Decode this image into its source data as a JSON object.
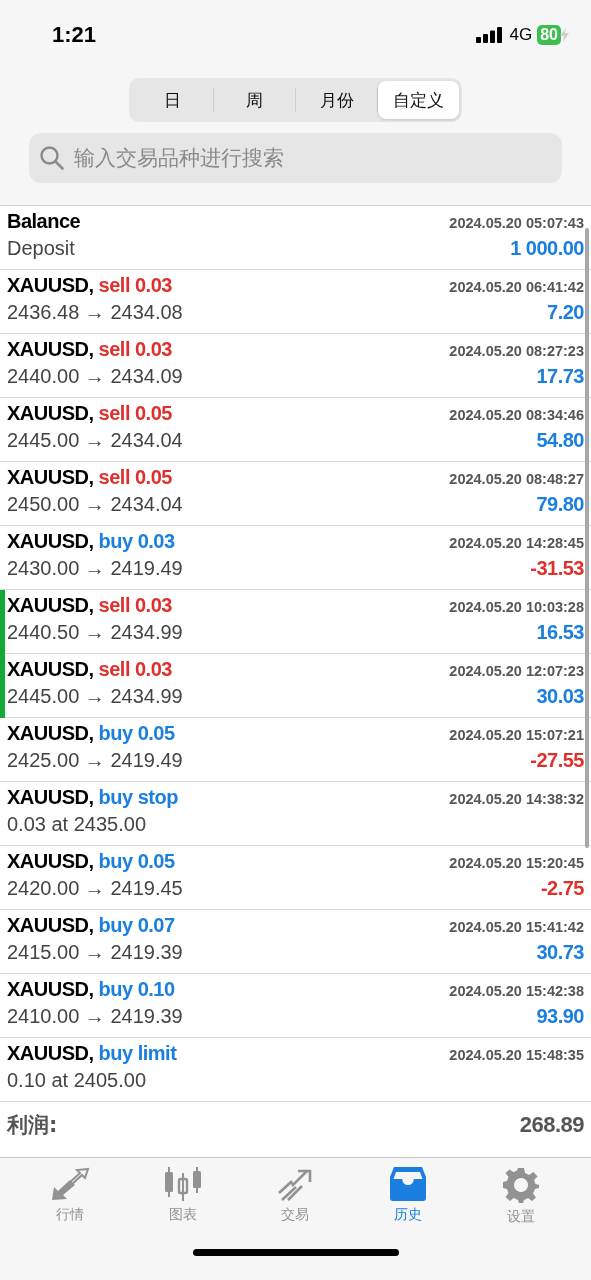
{
  "status_bar": {
    "time": "1:21",
    "network": "4G",
    "battery": "80"
  },
  "segments": [
    {
      "label": "日",
      "selected": false
    },
    {
      "label": "周",
      "selected": false
    },
    {
      "label": "月份",
      "selected": false
    },
    {
      "label": "自定义",
      "selected": true
    }
  ],
  "search": {
    "placeholder": "输入交易品种进行搜索"
  },
  "rows": [
    {
      "kind": "balance",
      "title": "Balance",
      "detail": "Deposit",
      "time": "2024.05.20 05:07:43",
      "amount": "1 000.00",
      "loss": false,
      "marked": false
    },
    {
      "kind": "trade",
      "title": "XAUUSD,",
      "action": {
        "text": "sell 0.03",
        "color": "#e0302b"
      },
      "detail": "2436.48 → 2434.08",
      "time": "2024.05.20 06:41:42",
      "amount": "7.20",
      "loss": false,
      "marked": false
    },
    {
      "kind": "trade",
      "title": "XAUUSD,",
      "action": {
        "text": "sell 0.03",
        "color": "#e0302b"
      },
      "detail": "2440.00 → 2434.09",
      "time": "2024.05.20 08:27:23",
      "amount": "17.73",
      "loss": false,
      "marked": false
    },
    {
      "kind": "trade",
      "title": "XAUUSD,",
      "action": {
        "text": "sell 0.05",
        "color": "#e0302b"
      },
      "detail": "2445.00 → 2434.04",
      "time": "2024.05.20 08:34:46",
      "amount": "54.80",
      "loss": false,
      "marked": false
    },
    {
      "kind": "trade",
      "title": "XAUUSD,",
      "action": {
        "text": "sell 0.05",
        "color": "#e0302b"
      },
      "detail": "2450.00 → 2434.04",
      "time": "2024.05.20 08:48:27",
      "amount": "79.80",
      "loss": false,
      "marked": false
    },
    {
      "kind": "trade",
      "title": "XAUUSD,",
      "action": {
        "text": "buy 0.03",
        "color": "#1a7fe0"
      },
      "detail": "2430.00 → 2419.49",
      "time": "2024.05.20 14:28:45",
      "amount": "-31.53",
      "loss": true,
      "marked": false
    },
    {
      "kind": "trade",
      "title": "XAUUSD,",
      "action": {
        "text": "sell 0.03",
        "color": "#e0302b"
      },
      "detail": "2440.50 → 2434.99",
      "time": "2024.05.20 10:03:28",
      "amount": "16.53",
      "loss": false,
      "marked": true
    },
    {
      "kind": "trade",
      "title": "XAUUSD,",
      "action": {
        "text": "sell 0.03",
        "color": "#e0302b"
      },
      "detail": "2445.00 → 2434.99",
      "time": "2024.05.20 12:07:23",
      "amount": "30.03",
      "loss": false,
      "marked": true
    },
    {
      "kind": "trade",
      "title": "XAUUSD,",
      "action": {
        "text": "buy 0.05",
        "color": "#1a7fe0"
      },
      "detail": "2425.00 → 2419.49",
      "time": "2024.05.20 15:07:21",
      "amount": "-27.55",
      "loss": true,
      "marked": false
    },
    {
      "kind": "order",
      "title": "XAUUSD,",
      "action": {
        "text": "buy stop",
        "color": "#1a7fe0"
      },
      "detail": "0.03 at 2435.00",
      "time": "2024.05.20 14:38:32",
      "marked": false
    },
    {
      "kind": "trade",
      "title": "XAUUSD,",
      "action": {
        "text": "buy 0.05",
        "color": "#1a7fe0"
      },
      "detail": "2420.00 → 2419.45",
      "time": "2024.05.20 15:20:45",
      "amount": "-2.75",
      "loss": true,
      "marked": false
    },
    {
      "kind": "trade",
      "title": "XAUUSD,",
      "action": {
        "text": "buy 0.07",
        "color": "#1a7fe0"
      },
      "detail": "2415.00 → 2419.39",
      "time": "2024.05.20 15:41:42",
      "amount": "30.73",
      "loss": false,
      "marked": false
    },
    {
      "kind": "trade",
      "title": "XAUUSD,",
      "action": {
        "text": "buy 0.10",
        "color": "#1a7fe0"
      },
      "detail": "2410.00 → 2419.39",
      "time": "2024.05.20 15:42:38",
      "amount": "93.90",
      "loss": false,
      "marked": false
    },
    {
      "kind": "order",
      "title": "XAUUSD,",
      "action": {
        "text": "buy limit",
        "color": "#1a7fe0"
      },
      "detail": "0.10 at 2405.00",
      "time": "2024.05.20 15:48:35",
      "marked": false
    }
  ],
  "summary": [
    {
      "label": "利润:",
      "value": "268.89"
    }
  ],
  "tab_bar": [
    {
      "label": "行情",
      "selected": false
    },
    {
      "label": "图表",
      "selected": false
    },
    {
      "label": "交易",
      "selected": false
    },
    {
      "label": "历史",
      "selected": true
    },
    {
      "label": "设置",
      "selected": false
    }
  ]
}
